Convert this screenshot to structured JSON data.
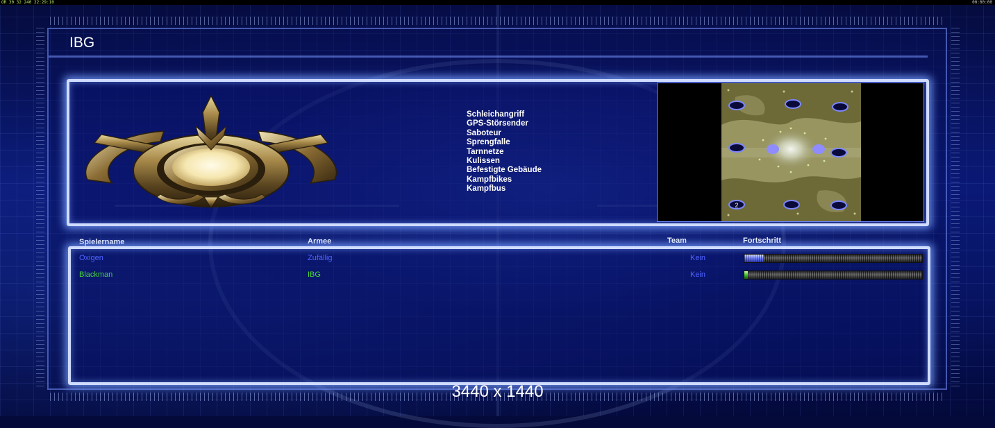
{
  "hud": {
    "left": "OR 30 32 240 22:29:10",
    "right": "00:00:00"
  },
  "title": "IBG",
  "features": [
    "Schleichangriff",
    "GPS-Störsender",
    "Saboteur",
    "Sprengfalle",
    "Tarnnetze",
    "Kulissen",
    "Befestigte Gebäude",
    "Kampfbikes",
    "Kampfbus"
  ],
  "minimap": {
    "start_label": "2"
  },
  "columns": {
    "name": "Spielername",
    "army": "Armee",
    "team": "Team",
    "progress": "Fortschritt"
  },
  "players": [
    {
      "name": "Oxigen",
      "army": "Zufällig",
      "team": "Kein",
      "color": "#4f63ff",
      "progress": 0.11
    },
    {
      "name": "Blackman",
      "army": "IBG",
      "team": "Kein",
      "color": "#49d43c",
      "progress": 0.02
    }
  ],
  "resolution": "3440 x 1440",
  "colors": {
    "panel_border": "#cfdcff",
    "background": "#0a1a78"
  }
}
